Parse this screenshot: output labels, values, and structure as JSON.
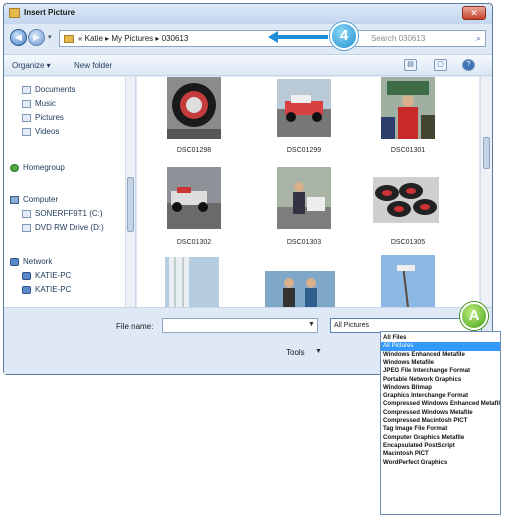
{
  "window": {
    "title": "Insert Picture",
    "close_glyph": "✕"
  },
  "address": {
    "back_glyph": "◀",
    "forward_glyph": "▶",
    "dropdown_glyph": "▾",
    "breadcrumb": "« Katie ▸ My Pictures ▸ 030613",
    "search_placeholder": "Search 030613",
    "search_glyph": "⌕"
  },
  "toolbar": {
    "organize_label": "Organize ▾",
    "new_folder_label": "New folder",
    "views_glyph": "▤",
    "preview_glyph": "▢",
    "help_glyph": "?"
  },
  "nav": {
    "items": [
      {
        "label": "Documents",
        "icon": "documents-icon"
      },
      {
        "label": "Music",
        "icon": "music-icon"
      },
      {
        "label": "Pictures",
        "icon": "pictures-icon"
      },
      {
        "label": "Videos",
        "icon": "videos-icon"
      },
      {
        "label": "Homegroup",
        "icon": "homegroup-icon"
      },
      {
        "label": "Computer",
        "icon": "computer-icon"
      },
      {
        "label": "SONERFF9T1 (C:)",
        "icon": "drive-icon"
      },
      {
        "label": "DVD RW Drive (D:)",
        "icon": "dvd-icon"
      },
      {
        "label": "Network",
        "icon": "network-icon"
      },
      {
        "label": "KATIE-PC",
        "icon": "pc-icon"
      },
      {
        "label": "KATIE-PC",
        "icon": "pc-icon"
      }
    ]
  },
  "files": [
    {
      "name": "DSC01298"
    },
    {
      "name": "DSC01299"
    },
    {
      "name": "DSC01301"
    },
    {
      "name": "DSC01302"
    },
    {
      "name": "DSC01303"
    },
    {
      "name": "DSC01305"
    }
  ],
  "bottom": {
    "file_name_label": "File name:",
    "file_name_value": "",
    "filter_value": "All Pictures",
    "tools_label": "Tools"
  },
  "dropdown_options": [
    "All Files",
    "All Pictures",
    "Windows Enhanced Metafile",
    "Windows Metafile",
    "JPEG File Interchange Format",
    "Portable Network Graphics",
    "Windows Bitmap",
    "Graphics Interchange Format",
    "Compressed Windows Enhanced Metafile",
    "Compressed Windows Metafile",
    "Compressed Macintosh PICT",
    "Tag Image File Format",
    "Computer Graphics Metafile",
    "Encapsulated PostScript",
    "Macintosh PICT",
    "WordPerfect Graphics"
  ],
  "dropdown_selected": "All Pictures",
  "callouts": {
    "step": "4",
    "marker": "A"
  },
  "colors": {
    "accent": "#1e8fd6",
    "selection": "#3399ff",
    "callout_green": "#4aa21c"
  }
}
